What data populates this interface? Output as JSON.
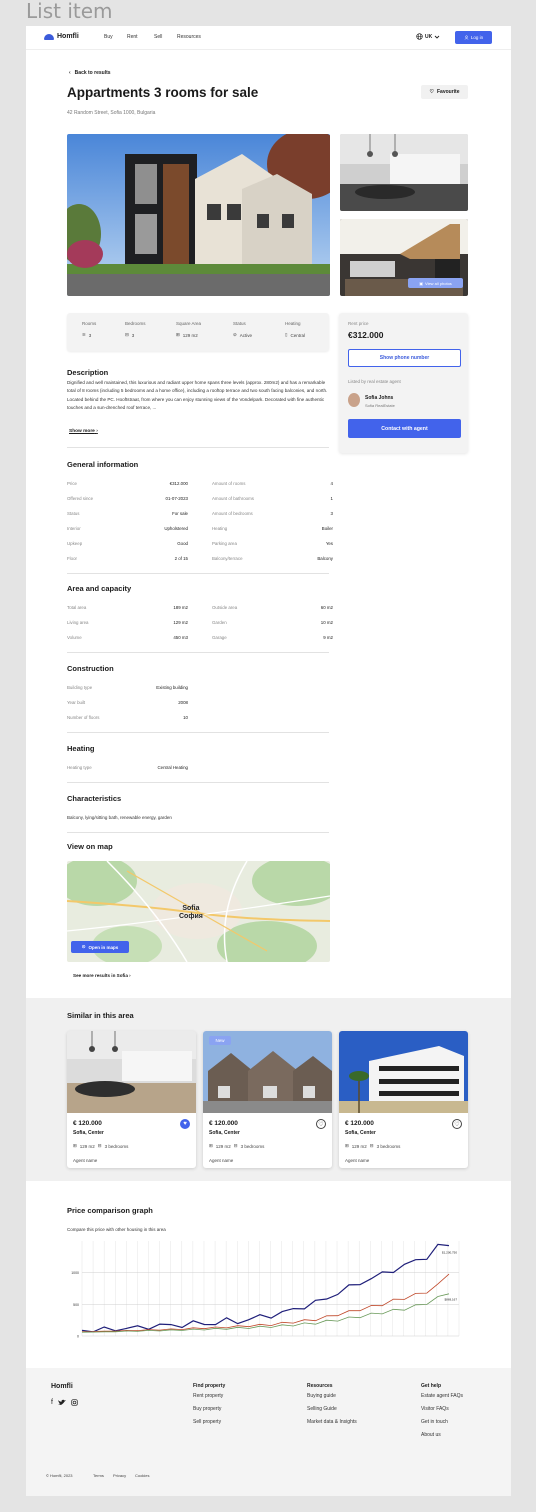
{
  "canvas_title": "List item",
  "header": {
    "logo": "Homfli",
    "nav": [
      "Buy",
      "Rent",
      "Sell",
      "Resources"
    ],
    "language": "UK",
    "login_label": "Log in"
  },
  "listing": {
    "back_label": "Back to results",
    "title": "Appartments 3 rooms for sale",
    "address": "42 Random Street, Sofia 1000, Bulgaria",
    "favourite_label": "Favourite",
    "view_all_photos": "View all photos"
  },
  "stats": [
    {
      "label": "Rooms",
      "value": "3",
      "icon": "layers-icon"
    },
    {
      "label": "Bedrooms",
      "value": "3",
      "icon": "bed-icon"
    },
    {
      "label": "Square Area",
      "value": "129 m2",
      "icon": "grid-icon"
    },
    {
      "label": "Status",
      "value": "Active",
      "icon": "check-circle-icon"
    },
    {
      "label": "Heating",
      "value": "Central",
      "icon": "thermometer-icon"
    }
  ],
  "price_card": {
    "label": "Rent price",
    "price": "€312.000",
    "show_phone": "Show phone number",
    "listed_by": "Listed by real estate agent",
    "agent_name": "Sofia Johns",
    "agent_company": "Sofia RealEstate",
    "contact_label": "Contact with agent"
  },
  "description": {
    "heading": "Description",
    "text": "Dignified and well maintained, this luxurious and radiant upper home spans three levels (approx. 280m2) and has a remarkable total of 8 rooms (including 5 bedrooms and a home office), including a rooftop terrace and two south facing balconies, and north. Located behind the PC. Hooftstraat, from where you can enjoy stunning views of the Vondelpark. Decorated with fine authentic touches and a sun-drenched roof terrace, ...",
    "show_more": "Show more"
  },
  "general": {
    "heading": "General information",
    "left": [
      [
        "Price",
        "€312.000"
      ],
      [
        "Offered since",
        "01-07-2023"
      ],
      [
        "Status",
        "For sale"
      ],
      [
        "Interior",
        "Upholstered"
      ],
      [
        "Upkeep",
        "Good"
      ],
      [
        "Floor",
        "2 of 15"
      ]
    ],
    "right": [
      [
        "Amount of rooms",
        "4"
      ],
      [
        "Amount of bathrooms",
        "1"
      ],
      [
        "Amount of bedrooms",
        "3"
      ],
      [
        "Heating",
        "Boiler"
      ],
      [
        "Parking area",
        "Yes"
      ],
      [
        "Balcony/terrace",
        "Balcony"
      ]
    ]
  },
  "area": {
    "heading": "Area and capacity",
    "left": [
      [
        "Total area",
        "189 m2"
      ],
      [
        "Living area",
        "129 m2"
      ],
      [
        "Volume",
        "450 m3"
      ]
    ],
    "right": [
      [
        "Outside area",
        "60 m2"
      ],
      [
        "Garden",
        "10 m2"
      ],
      [
        "Garage",
        "9 m2"
      ]
    ]
  },
  "construction": {
    "heading": "Construction",
    "rows": [
      [
        "Building type",
        "Existing building"
      ],
      [
        "Year built",
        "2008"
      ],
      [
        "Number of floors",
        "10"
      ]
    ]
  },
  "heating": {
    "heading": "Heating",
    "rows": [
      [
        "Heating type",
        "Central Heating"
      ]
    ]
  },
  "characteristics": {
    "heading": "Characteristics",
    "text": "Balcony, lying/sitting bath, renewable energy, garden"
  },
  "map": {
    "heading": "View on map",
    "city_latin": "Sofia",
    "city_cyrillic": "София",
    "open_label": "Open in maps",
    "see_more": "See more results in Sofia"
  },
  "similar": {
    "heading": "Similar in this area",
    "cards": [
      {
        "price": "€ 120.000",
        "location": "Sofia, Center",
        "area": "129 m2",
        "bedrooms": "3 bedrooms",
        "agent": "Agent name",
        "badge": "",
        "favourited": true
      },
      {
        "price": "€ 120.000",
        "location": "Sofia, Center",
        "area": "129 m2",
        "bedrooms": "3 bedrooms",
        "agent": "Agent name",
        "badge": "New",
        "favourited": false
      },
      {
        "price": "€ 120.000",
        "location": "Sofia, Center",
        "area": "129 m2",
        "bedrooms": "3 bedrooms",
        "agent": "Agent name",
        "badge": "",
        "favourited": false
      }
    ]
  },
  "price_graph": {
    "heading": "Price comparison graph",
    "subtitle": "Compare this price with other housing in this area",
    "end_labels": [
      "$1,200,750",
      "$869,167"
    ]
  },
  "chart_data": {
    "type": "line",
    "title": "Price comparison graph",
    "subtitle": "Compare this price with other housing in this area",
    "xlabel": "",
    "ylabel": "",
    "ylim": [
      0,
      1500
    ],
    "yticks": [
      0,
      500,
      1000
    ],
    "grid": true,
    "series": [
      {
        "color": "#1f1f7a",
        "values": [
          90,
          100,
          95,
          110,
          130,
          120,
          150,
          170,
          160,
          180,
          200,
          190,
          210,
          240,
          230,
          260,
          300,
          330,
          360,
          420,
          470,
          520,
          600,
          680,
          760,
          850,
          900,
          980,
          1050,
          1100,
          1200,
          1250,
          1400,
          1450
        ]
      },
      {
        "color": "#c0482a",
        "values": [
          70,
          72,
          75,
          80,
          85,
          90,
          95,
          100,
          105,
          110,
          120,
          125,
          130,
          140,
          150,
          160,
          170,
          180,
          200,
          220,
          240,
          260,
          300,
          340,
          380,
          420,
          460,
          500,
          560,
          600,
          650,
          700,
          800,
          1000
        ]
      },
      {
        "color": "#6a9a5a",
        "values": [
          60,
          62,
          65,
          70,
          75,
          78,
          82,
          86,
          90,
          95,
          100,
          105,
          110,
          118,
          125,
          132,
          140,
          150,
          160,
          175,
          190,
          205,
          230,
          255,
          280,
          310,
          340,
          370,
          400,
          430,
          470,
          520,
          600,
          690
        ]
      }
    ]
  },
  "footer": {
    "logo": "Homfli",
    "columns": [
      {
        "heading": "Find property",
        "links": [
          "Rent property",
          "Buy property",
          "Sell property"
        ]
      },
      {
        "heading": "Resources",
        "links": [
          "Buying guide",
          "Selling Guide",
          "Market data & Insights"
        ]
      },
      {
        "heading": "Get help",
        "links": [
          "Estate agent FAQs",
          "Visitor FAQs",
          "Get in touch",
          "About us"
        ]
      }
    ],
    "copyright": "© Homfli, 2023",
    "legal": [
      "Terms",
      "Privacy",
      "Cookies"
    ]
  }
}
